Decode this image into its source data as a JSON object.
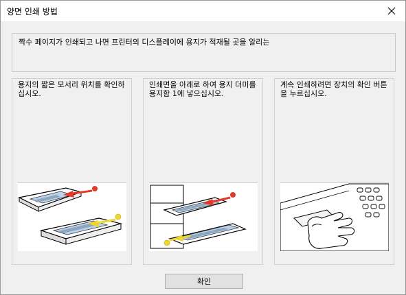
{
  "window": {
    "title": "양면 인쇄 방법"
  },
  "description": "짝수 페이지가 인쇄되고 나면 프린터의 디스플레이에 용지가 적재될 곳을 알리는",
  "panels": [
    {
      "text": "용지의 짧은 모서리 위치를 확인하십시오."
    },
    {
      "text": "인쇄면을 아래로 하여 용지 더미를 용지함 1에 넣으십시오."
    },
    {
      "text": "계속 인쇄하려면 장치의 확인 버튼을 누르십시오."
    }
  ],
  "buttons": {
    "ok_label": "확인"
  },
  "icons": {
    "close": "close-icon"
  },
  "colors": {
    "marker_red": "#e23a2a",
    "marker_yellow": "#f0d52a",
    "paper_blue": "#bcd3ee"
  }
}
